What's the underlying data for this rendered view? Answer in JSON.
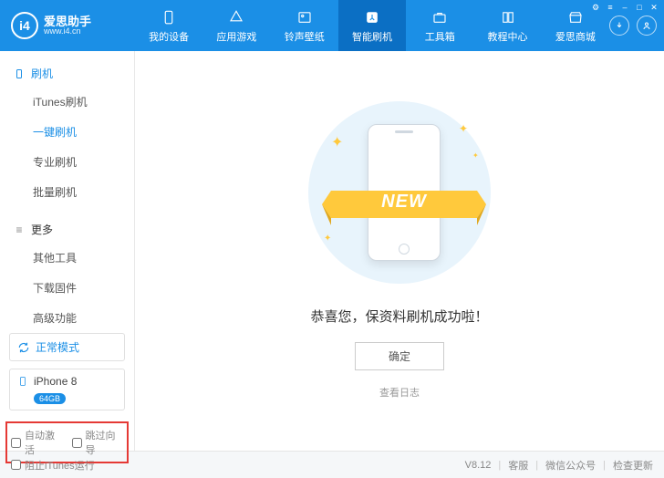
{
  "brand": {
    "name": "爱思助手",
    "url": "www.i4.cn",
    "logo_text": "i4"
  },
  "nav": [
    {
      "label": "我的设备"
    },
    {
      "label": "应用游戏"
    },
    {
      "label": "铃声壁纸"
    },
    {
      "label": "智能刷机"
    },
    {
      "label": "工具箱"
    },
    {
      "label": "教程中心"
    },
    {
      "label": "爱思商城"
    }
  ],
  "sidebar": {
    "section1": {
      "title": "刷机",
      "items": [
        "iTunes刷机",
        "一键刷机",
        "专业刷机",
        "批量刷机"
      ],
      "active_index": 1
    },
    "section2": {
      "title": "更多",
      "items": [
        "其他工具",
        "下载固件",
        "高级功能"
      ]
    },
    "mode": "正常模式",
    "device": {
      "name": "iPhone 8",
      "storage": "64GB"
    },
    "checks": {
      "auto_activate": "自动激活",
      "skip_guide": "跳过向导"
    }
  },
  "content": {
    "ribbon": "NEW",
    "success": "恭喜您，保资料刷机成功啦！",
    "ok": "确定",
    "view_log": "查看日志"
  },
  "footer": {
    "block_itunes": "阻止iTunes运行",
    "version": "V8.12",
    "support": "客服",
    "wechat": "微信公众号",
    "update": "检查更新"
  }
}
